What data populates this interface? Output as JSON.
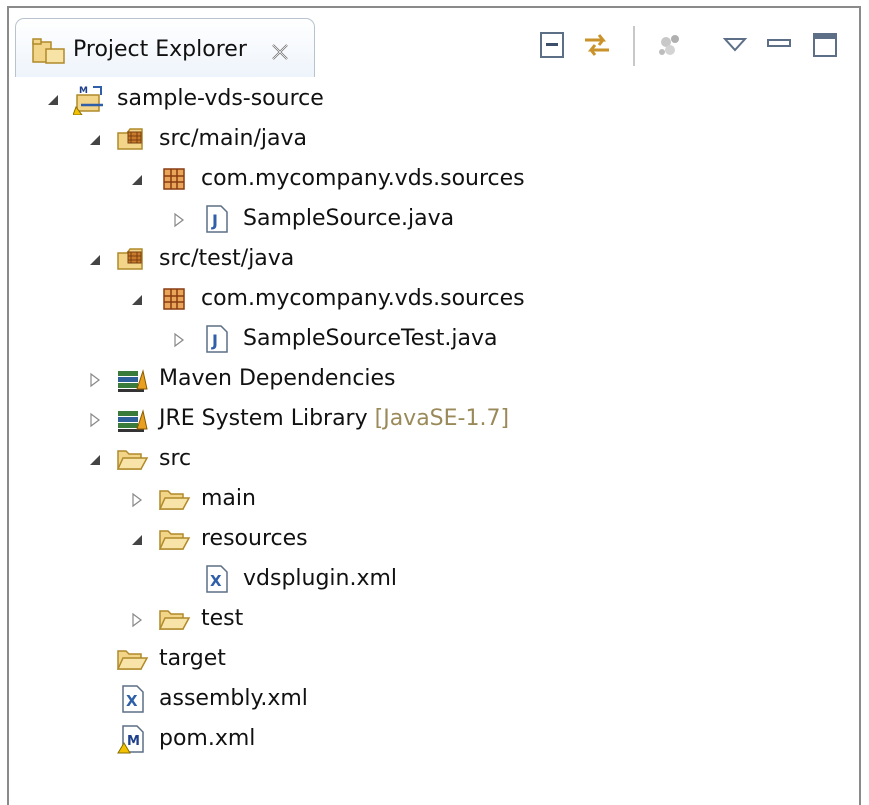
{
  "view": {
    "title": "Project Explorer",
    "toolbar": [
      "collapse-all-icon",
      "link-with-editor-icon",
      "focus-on-active-task-icon",
      "view-menu-icon",
      "minimize-icon",
      "maximize-icon"
    ]
  },
  "tree": {
    "project": "sample-vds-source",
    "src_main_java": "src/main/java",
    "pkg_main": "com.mycompany.vds.sources",
    "sample_source": "SampleSource.java",
    "src_test_java": "src/test/java",
    "pkg_test": "com.mycompany.vds.sources",
    "sample_source_test": "SampleSourceTest.java",
    "maven_deps": "Maven Dependencies",
    "jre_lib": "JRE System Library",
    "jre_version": "[JavaSE-1.7]",
    "src": "src",
    "main": "main",
    "resources": "resources",
    "vdsplugin": "vdsplugin.xml",
    "test": "test",
    "target": "target",
    "assembly": "assembly.xml",
    "pom": "pom.xml"
  },
  "colors": {
    "tab_border": "#b9c3cf",
    "folder": "#e9b84a",
    "package": "#b5651d",
    "java_icon": "#2f5fa8",
    "decoration_text": "#9a8a5a"
  }
}
